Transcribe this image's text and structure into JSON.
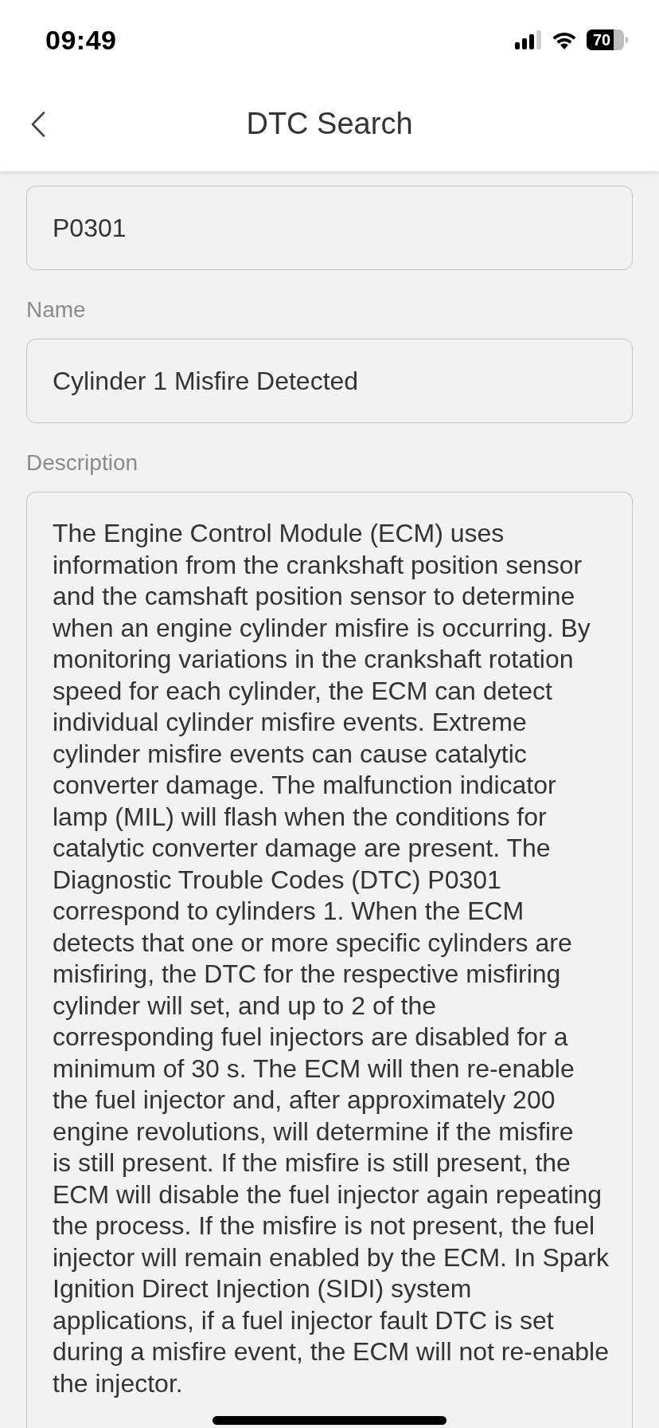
{
  "status_bar": {
    "time": "09:49",
    "battery": "70"
  },
  "header": {
    "title": "DTC Search"
  },
  "fields": [
    {
      "kind": "single",
      "value": "P0301"
    },
    {
      "kind": "single",
      "label": "Name",
      "value": "Cylinder 1 Misfire Detected"
    },
    {
      "kind": "multiline",
      "label": "Description",
      "value": "The Engine Control Module (ECM) uses\ninformation from the crankshaft position sensor\nand the camshaft position sensor to determine\nwhen an engine cylinder misfire is occurring. By\nmonitoring variations in the crankshaft rotation\nspeed for each cylinder, the ECM can detect\nindividual cylinder misfire events. Extreme\ncylinder misfire events can cause catalytic\nconverter damage. The malfunction indicator\nlamp (MIL) will flash when the conditions for\ncatalytic converter damage are present. The\nDiagnostic Trouble Codes (DTC) P0301\ncorrespond to cylinders 1. When the ECM\ndetects that one or more specific cylinders are\nmisfiring, the DTC for the respective misfiring\ncylinder will set, and up to 2 of the\ncorresponding fuel injectors are disabled for a\nminimum of 30 s. The ECM will then re-enable\nthe fuel injector and, after approximately 200\nengine revolutions, will determine if the misfire\nis still present. If the misfire is still present, the\nECM will disable the fuel injector again repeating\nthe process. If the misfire is not present, the fuel\ninjector will remain enabled by the ECM. In Spark\nIgnition Direct Injection (SIDI) system\napplications, if a fuel injector fault DTC is set\nduring a misfire event, the ECM will not re-enable\nthe injector."
    }
  ]
}
